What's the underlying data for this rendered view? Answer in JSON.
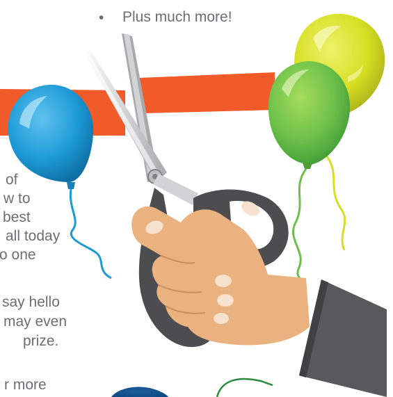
{
  "bullet_list": {
    "item_last": "Plus much more!"
  },
  "paragraph1": {
    "lines": [
      "of",
      "w to",
      "best",
      "all today",
      "o one"
    ]
  },
  "paragraph2": {
    "lines": [
      "say hello",
      "may even",
      "prize."
    ]
  },
  "paragraph3": {
    "lines": [
      "r more"
    ]
  },
  "colors": {
    "text": "#6d6e71",
    "ribbon": "#f15a29",
    "balloon_blue": "#1c9ad6",
    "balloon_green": "#6cc04a",
    "balloon_yellow": "#d7df23",
    "scissor_handle": "#4d4d4f",
    "skin": "#e9b27e",
    "sleeve": "#58595b"
  }
}
